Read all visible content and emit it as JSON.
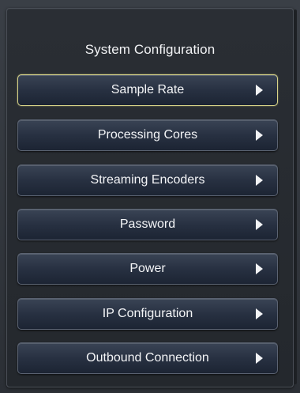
{
  "panel": {
    "title": "System Configuration"
  },
  "menu": {
    "items": [
      {
        "label": "Sample Rate",
        "icon": "arrow-right-icon",
        "selected": true
      },
      {
        "label": "Processing Cores",
        "icon": "arrow-right-icon",
        "selected": false
      },
      {
        "label": "Streaming Encoders",
        "icon": "arrow-right-icon",
        "selected": false
      },
      {
        "label": "Password",
        "icon": "arrow-right-icon",
        "selected": false
      },
      {
        "label": "Power",
        "icon": "arrow-right-icon",
        "selected": false
      },
      {
        "label": "IP Configuration",
        "icon": "arrow-right-icon",
        "selected": false
      },
      {
        "label": "Outbound Connection",
        "icon": "arrow-right-icon",
        "selected": false
      }
    ]
  },
  "colors": {
    "selected_border": "#d8d488",
    "button_gradient_top": "#3a4455",
    "button_gradient_bottom": "#1c2433",
    "text": "#f4f5f7"
  }
}
